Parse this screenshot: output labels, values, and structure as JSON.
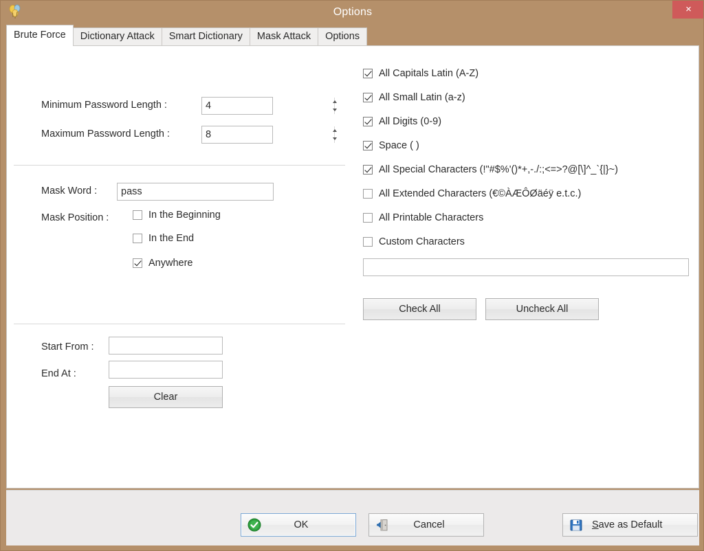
{
  "window": {
    "title": "Options",
    "icon": "balloons-icon",
    "close_label": "×",
    "border_color": "#b5906a",
    "titlebar_color": "#b5906a",
    "close_color": "#cf5a5a"
  },
  "tabs": [
    {
      "label": "Brute Force",
      "active": true
    },
    {
      "label": "Dictionary Attack",
      "active": false
    },
    {
      "label": "Smart Dictionary",
      "active": false
    },
    {
      "label": "Mask Attack",
      "active": false
    },
    {
      "label": "Options",
      "active": false
    }
  ],
  "left_panel": {
    "min_length_label": "Minimum Password Length :",
    "min_length_value": "4",
    "max_length_label": "Maximum Password Length :",
    "max_length_value": "8",
    "mask_word_label": "Mask Word :",
    "mask_word_value": "pass",
    "mask_position_label": "Mask Position :",
    "mask_positions": [
      {
        "label": "In the Beginning",
        "checked": false
      },
      {
        "label": "In the End",
        "checked": false
      },
      {
        "label": "Anywhere",
        "checked": true
      }
    ],
    "start_from_label": "Start From :",
    "start_from_value": "",
    "end_at_label": "End At :",
    "end_at_value": "",
    "clear_label": "Clear"
  },
  "right_panel": {
    "charsets": [
      {
        "label": "All Capitals Latin (A-Z)",
        "checked": true
      },
      {
        "label": "All Small Latin (a-z)",
        "checked": true
      },
      {
        "label": "All Digits (0-9)",
        "checked": true
      },
      {
        "label": "Space ( )",
        "checked": true
      },
      {
        "label": "All Special Characters (!\"#$%'()*+,-./:;<=>?@[\\]^_`{|}~)",
        "checked": true
      },
      {
        "label": "All Extended Characters (€©ÀÆÔØäéÿ e.t.c.)",
        "checked": false
      },
      {
        "label": "All Printable Characters",
        "checked": false
      },
      {
        "label": "Custom Characters",
        "checked": false
      }
    ],
    "custom_characters_value": "",
    "check_all_label": "Check All",
    "uncheck_all_label": "Uncheck All"
  },
  "footer": {
    "ok_label": "OK",
    "ok_icon": "green-check-icon",
    "cancel_label": "Cancel",
    "cancel_icon": "door-exit-icon",
    "save_default_accel": "S",
    "save_default_label": "ave as Default",
    "save_default_icon": "floppy-disk-icon"
  }
}
